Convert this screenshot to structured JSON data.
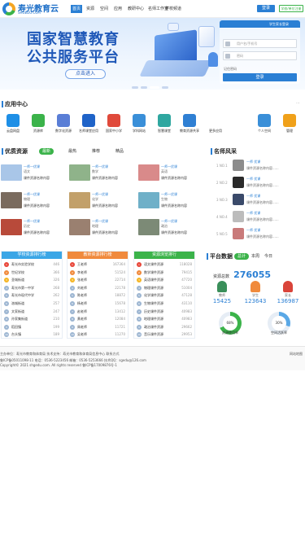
{
  "header": {
    "logo_name": "寿光教育云",
    "logo_sub": "SHGEDU.COM",
    "nav": [
      "首页",
      "资源",
      "空间",
      "应用",
      "教研中心",
      "名师工作室",
      "学校频道"
    ],
    "login": "登录",
    "register": "学校/单位注册"
  },
  "banner": {
    "title_line1": "国家智慧教育",
    "title_line2": "公共服务平台",
    "cta": "点击进入"
  },
  "login_panel": {
    "header": "学生家长登录",
    "username_placeholder": "用户名/手机号",
    "password_placeholder": "密码",
    "remember": "记住密码",
    "submit": "登录"
  },
  "apps": {
    "title": "应用中心",
    "more": "···",
    "items": [
      {
        "label": "云盘网盘",
        "color": "#1e8fe6",
        "icon": "cloud-icon"
      },
      {
        "label": "资源库",
        "color": "#3bb34a",
        "icon": "folder-icon"
      },
      {
        "label": "数字化资源",
        "color": "#5a7ed6",
        "icon": "library-icon"
      },
      {
        "label": "名师课堂应用",
        "color": "#1f63c8",
        "icon": "video-icon"
      },
      {
        "label": "国家中小学",
        "color": "#e04a3b",
        "icon": "school-icon"
      },
      {
        "label": "学科网站",
        "color": "#3a8fd8",
        "icon": "book-icon"
      },
      {
        "label": "智慧课堂",
        "color": "#2fa7a0",
        "icon": "class-icon"
      },
      {
        "label": "教育资源共享",
        "color": "#2f7fd3",
        "icon": "share-icon"
      },
      {
        "label": "更多应用",
        "color": "#ffffff",
        "icon": "more-icon"
      },
      {
        "label": "个人空间",
        "color": "#3a8fd8",
        "icon": "user-icon"
      },
      {
        "label": "管理",
        "color": "#f0a11a",
        "icon": "tools-icon"
      }
    ]
  },
  "resources": {
    "title": "优质资源",
    "tabs": [
      "最新",
      "最热",
      "推荐",
      "精品"
    ],
    "cards": [
      {
        "t1": "一师一优课",
        "t2": "语文",
        "t3": "课件资源名称内容",
        "thumb": "#a9c6e8"
      },
      {
        "t1": "一师一优课",
        "t2": "数学",
        "t3": "课件资源名称内容",
        "thumb": "#8fb38a"
      },
      {
        "t1": "一师一优课",
        "t2": "英语",
        "t3": "课件资源名称内容",
        "thumb": "#d98a8a"
      },
      {
        "t1": "一师一优课",
        "t2": "物理",
        "t3": "课件资源名称内容",
        "thumb": "#7a6b5e"
      },
      {
        "t1": "一师一优课",
        "t2": "化学",
        "t3": "课件资源名称内容",
        "thumb": "#c2a06a"
      },
      {
        "t1": "一师一优课",
        "t2": "生物",
        "t3": "课件资源名称内容",
        "thumb": "#6fb0c8"
      },
      {
        "t1": "一师一优课",
        "t2": "历史",
        "t3": "课件资源名称内容",
        "thumb": "#b84a3a"
      },
      {
        "t1": "一师一优课",
        "t2": "地理",
        "t3": "课件资源名称内容",
        "thumb": "#9a8070"
      },
      {
        "t1": "一师一优课",
        "t2": "政治",
        "t3": "课件资源名称内容",
        "thumb": "#7c8a76"
      }
    ]
  },
  "teachers": {
    "title": "名师风采",
    "items": [
      {
        "rank": "1 NO.1",
        "name": "一师 优课",
        "desc": "课件资源名称内容......",
        "color": "#8c8c8c"
      },
      {
        "rank": "2 NO.2",
        "name": "一师 优课",
        "desc": "课件资源名称内容......",
        "color": "#2a2a2a"
      },
      {
        "rank": "3 NO.3",
        "name": "一师 优课",
        "desc": "课件资源名称内容......",
        "color": "#3a4a6a"
      },
      {
        "rank": "4 NO.4",
        "name": "一师 优课",
        "desc": "课件资源名称内容......",
        "color": "#bcbcbc"
      },
      {
        "rank": "5 NO.5",
        "name": "一师 优课",
        "desc": "课件资源名称内容......",
        "color": "#c97a7a"
      }
    ]
  },
  "rankings": [
    {
      "title": "学校资源排行榜",
      "color": "#3aa6e6",
      "rows": [
        {
          "name": "寿光市实验学校",
          "value": "446"
        },
        {
          "name": "世纪学校",
          "value": "366"
        },
        {
          "name": "圣城街道",
          "value": "326"
        },
        {
          "name": "寿光市第一中学",
          "value": "268"
        },
        {
          "name": "寿光市现代中学",
          "value": "262"
        },
        {
          "name": "洛城街道",
          "value": "257"
        },
        {
          "name": "文家街道",
          "value": "247"
        },
        {
          "name": "孙家集街道",
          "value": "210"
        },
        {
          "name": "稻田镇",
          "value": "199"
        },
        {
          "name": "台头镇",
          "value": "189"
        }
      ]
    },
    {
      "title": "教师资源排行榜",
      "color": "#f08a3c",
      "rows": [
        {
          "name": "王老师",
          "value": "167364"
        },
        {
          "name": "李老师",
          "value": "51524"
        },
        {
          "name": "张老师",
          "value": "22714"
        },
        {
          "name": "刘老师",
          "value": "22178"
        },
        {
          "name": "陈老师",
          "value": "18872"
        },
        {
          "name": "杨老师",
          "value": "15678"
        },
        {
          "name": "赵老师",
          "value": "13412"
        },
        {
          "name": "黄老师",
          "value": "12084"
        },
        {
          "name": "周老师",
          "value": "11721"
        },
        {
          "name": "吴老师",
          "value": "11270"
        }
      ]
    },
    {
      "title": "资源浏览排行",
      "color": "#3bb34a",
      "rows": [
        {
          "name": "语文课件资源",
          "value": "118028"
        },
        {
          "name": "数学课件资源",
          "value": "79415"
        },
        {
          "name": "英语课件资源",
          "value": "47720"
        },
        {
          "name": "物理课件资源",
          "value": "51004"
        },
        {
          "name": "化学课件资源",
          "value": "47128"
        },
        {
          "name": "生物课件资源",
          "value": "43110"
        },
        {
          "name": "历史课件资源",
          "value": "40983"
        },
        {
          "name": "地理课件资源",
          "value": "40983"
        },
        {
          "name": "政治课件资源",
          "value": "29662"
        },
        {
          "name": "音乐课件资源",
          "value": "29953"
        }
      ]
    }
  ],
  "stats": {
    "title": "平台数据",
    "tabs": [
      "总计",
      "本周",
      "今日"
    ],
    "total_label": "资源总数",
    "total": "276055",
    "items": [
      {
        "label": "教师",
        "value": "15425",
        "color": "#3a8f5a"
      },
      {
        "label": "学生",
        "value": "123643",
        "color": "#f08a3c"
      },
      {
        "label": "家长",
        "value": "136987",
        "color": "#d9443a"
      }
    ],
    "rings": [
      {
        "value": "68%",
        "label": "资源使用率",
        "color": "#3bb34a",
        "fraction": 0.68
      },
      {
        "value": "30%",
        "label": "空间活跃率",
        "color": "#5aa8e6",
        "fraction": 0.3
      }
    ]
  },
  "footer": {
    "line1": "主办单位：寿光市教育和体育局 技术支持：寿光市教育和体育局信息中心 联系方式",
    "line2": "鲁ICP备05011098-11 电话：0536-5223456  邮箱：0536-5253666  技术QQ：sgedu@126.com",
    "line3": "Copyright© 2021 shgedu.com. All rights reserved 鲁ICP备17009876号-1",
    "right": "网站地图"
  }
}
